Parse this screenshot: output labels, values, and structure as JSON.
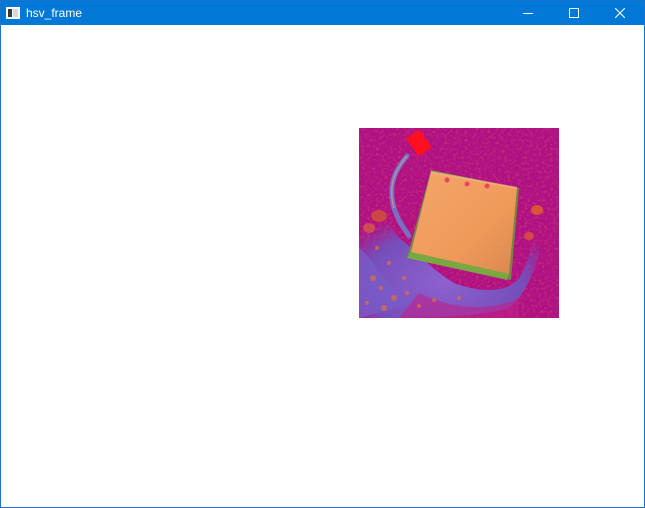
{
  "window": {
    "title": "hsv_frame",
    "accent_color": "#0078d7",
    "icons": {
      "app": "opencv-window-icon",
      "minimize": "minimize-icon",
      "maximize": "maximize-icon",
      "close": "close-icon"
    }
  },
  "frame": {
    "description_colors": {
      "background": "#b0127f",
      "object": "#f0a060",
      "shadow": "#7a5cc8",
      "marker": "#ff1020"
    }
  }
}
